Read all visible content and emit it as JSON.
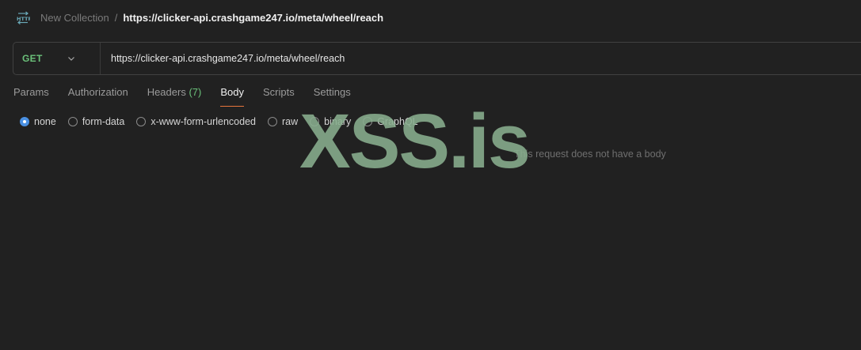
{
  "breadcrumb": {
    "collection": "New Collection",
    "separator": "/",
    "current": "https://clicker-api.crashgame247.io/meta/wheel/reach"
  },
  "request": {
    "method": "GET",
    "url": "https://clicker-api.crashgame247.io/meta/wheel/reach"
  },
  "tabs": {
    "params": "Params",
    "authorization": "Authorization",
    "headers": "Headers",
    "headers_count": "(7)",
    "body": "Body",
    "scripts": "Scripts",
    "settings": "Settings",
    "active": "Body"
  },
  "body_types": {
    "none": "none",
    "form_data": "form-data",
    "urlencoded": "x-www-form-urlencoded",
    "raw": "raw",
    "binary": "binary",
    "graphql": "GraphQL",
    "selected": "none"
  },
  "empty_message": "This request does not have a body",
  "watermark": "XSS.is",
  "colors": {
    "method_get": "#6bc17a",
    "active_tab_underline": "#e8763c",
    "radio_selected": "#4a90e2",
    "background": "#212121"
  }
}
